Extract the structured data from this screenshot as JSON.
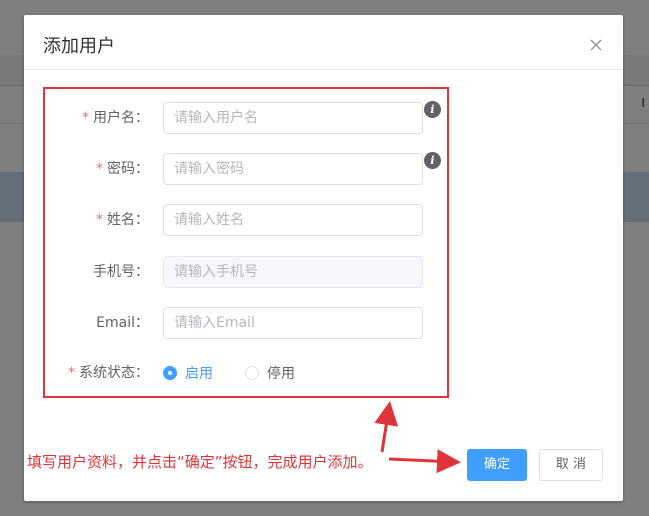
{
  "dialog": {
    "title": "添加用户"
  },
  "form": {
    "username": {
      "label": "用户名：",
      "placeholder": "请输入用户名",
      "required": true
    },
    "password": {
      "label": "密码：",
      "placeholder": "请输入密码",
      "required": true
    },
    "name": {
      "label": "姓名：",
      "placeholder": "请输入姓名",
      "required": true
    },
    "phone": {
      "label": "手机号：",
      "placeholder": "请输入手机号",
      "required": false
    },
    "email": {
      "label": "Email：",
      "placeholder": "请输入Email",
      "required": false
    },
    "status": {
      "label": "系统状态：",
      "required": true,
      "options": [
        "启用",
        "停用"
      ],
      "selected": "启用"
    },
    "required_mark": "*",
    "info_icon_glyph": "i"
  },
  "annotation": {
    "text": "填写用户资料，并点击“确定”按钮，完成用户添加。"
  },
  "buttons": {
    "confirm": "确定",
    "cancel": "取 消"
  },
  "colors": {
    "accent": "#409eff",
    "annotation": "#e0343a",
    "required": "#f56c6c"
  }
}
